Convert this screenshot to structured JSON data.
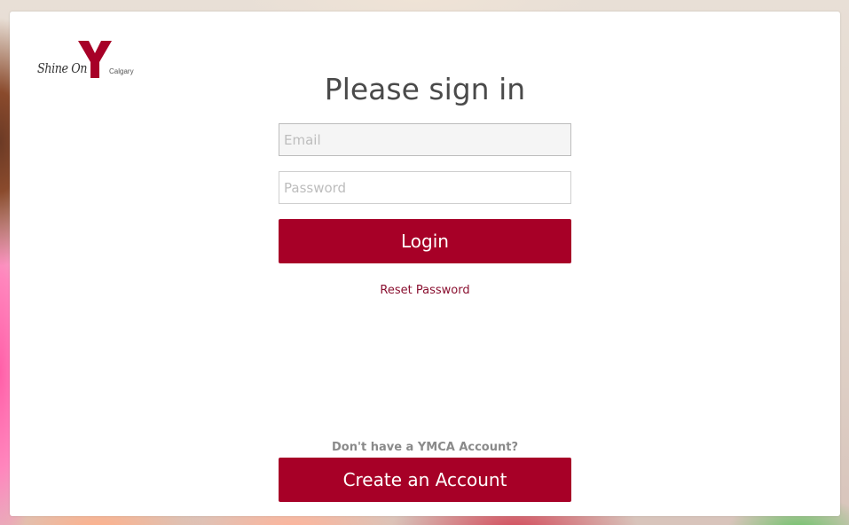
{
  "brand": {
    "tagline": "Shine On",
    "city": "Calgary",
    "color": "#a70027"
  },
  "page": {
    "title": "Please sign in"
  },
  "form": {
    "email_placeholder": "Email",
    "email_value": "",
    "password_placeholder": "Password",
    "password_value": "",
    "login_label": "Login",
    "reset_label": "Reset Password"
  },
  "signup": {
    "prompt": "Don't have a YMCA Account?",
    "button_label": "Create an Account"
  },
  "icons": {
    "logo": "ymca-y-logo"
  }
}
